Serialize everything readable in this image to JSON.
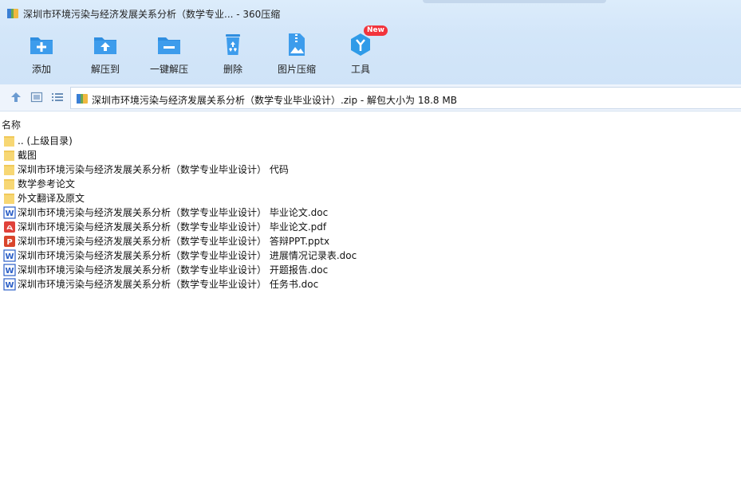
{
  "window": {
    "title": "深圳市环境污染与经济发展关系分析（数学专业... - 360压缩"
  },
  "toolbar": {
    "items": [
      {
        "label": "添加",
        "icon": "add-folder-icon"
      },
      {
        "label": "解压到",
        "icon": "extract-to-icon"
      },
      {
        "label": "一键解压",
        "icon": "one-click-extract-icon"
      },
      {
        "label": "删除",
        "icon": "recycle-delete-icon"
      },
      {
        "label": "图片压缩",
        "icon": "image-compress-icon"
      },
      {
        "label": "工具",
        "icon": "tools-icon",
        "badge": "New"
      }
    ]
  },
  "addressbar": {
    "path": "深圳市环境污染与经济发展关系分析（数学专业毕业设计）.zip - 解包大小为 18.8 MB"
  },
  "filelist": {
    "column_name": "名称",
    "rows": [
      {
        "name": ".. (上级目录)",
        "type": "folder"
      },
      {
        "name": "截图",
        "type": "folder"
      },
      {
        "name": "深圳市环境污染与经济发展关系分析（数学专业毕业设计） 代码",
        "type": "folder"
      },
      {
        "name": "数学参考论文",
        "type": "folder"
      },
      {
        "name": "外文翻译及原文",
        "type": "folder"
      },
      {
        "name": "深圳市环境污染与经济发展关系分析（数学专业毕业设计） 毕业论文.doc",
        "type": "word"
      },
      {
        "name": "深圳市环境污染与经济发展关系分析（数学专业毕业设计） 毕业论文.pdf",
        "type": "pdf"
      },
      {
        "name": "深圳市环境污染与经济发展关系分析（数学专业毕业设计） 答辩PPT.pptx",
        "type": "ppt"
      },
      {
        "name": "深圳市环境污染与经济发展关系分析（数学专业毕业设计） 进展情况记录表.doc",
        "type": "word"
      },
      {
        "name": "深圳市环境污染与经济发展关系分析（数学专业毕业设计） 开题报告.doc",
        "type": "word"
      },
      {
        "name": "深圳市环境污染与经济发展关系分析（数学专业毕业设计） 任务书.doc",
        "type": "word"
      }
    ]
  },
  "colors": {
    "accent": "#2f8ee0",
    "folder": "#f7d774",
    "word": "#2b5fc7",
    "pdf": "#e0413a",
    "ppt": "#d9452b"
  }
}
